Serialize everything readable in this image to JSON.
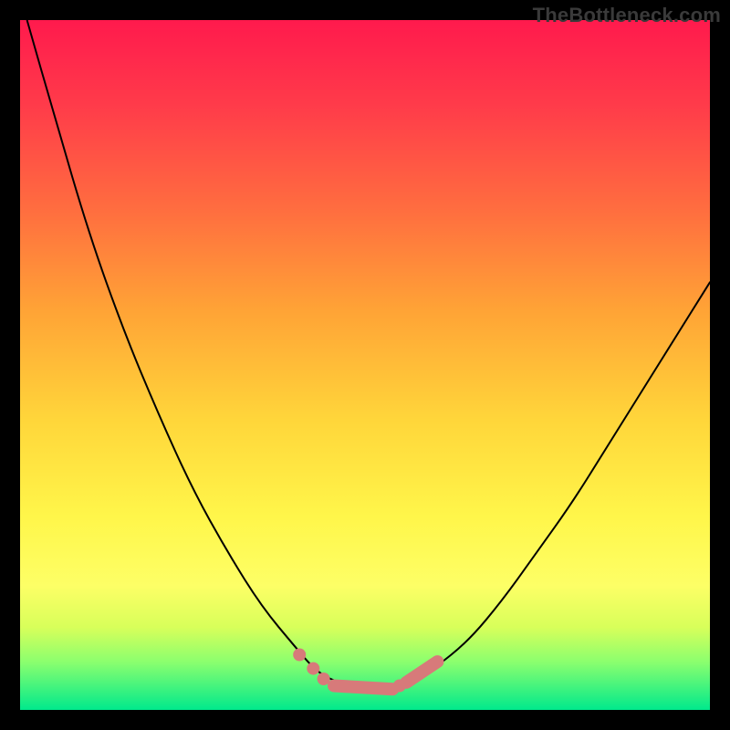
{
  "watermark": "TheBottleneck.com",
  "colors": {
    "background": "#000000",
    "curve": "#000000",
    "markers": "#d77a7a",
    "gradient_top": "#ff1a4d",
    "gradient_bottom": "#00e98c"
  },
  "chart_data": {
    "type": "line",
    "title": "",
    "xlabel": "",
    "ylabel": "",
    "xlim": [
      0,
      100
    ],
    "ylim": [
      0,
      100
    ],
    "grid": false,
    "legend": false,
    "note": "V-shaped bottleneck curve over a vertical rainbow gradient. Values estimated from pixel positions (top-left origin inside the 756×756 plot area). Higher y = further down the image (toward green/good zone).",
    "series": [
      {
        "name": "curve",
        "x": [
          1,
          5,
          10,
          15,
          20,
          25,
          30,
          35,
          40,
          43,
          46,
          50,
          54,
          57,
          60,
          65,
          70,
          75,
          80,
          85,
          90,
          95,
          100
        ],
        "y": [
          0,
          14,
          31,
          45,
          57,
          68,
          77,
          85,
          91,
          94.5,
          96,
          97,
          97,
          96,
          94,
          90,
          84,
          77,
          70,
          62,
          54,
          46,
          38
        ]
      }
    ],
    "markers": [
      {
        "type": "dot",
        "x": 40.5,
        "y": 92
      },
      {
        "type": "dot",
        "x": 42.5,
        "y": 94
      },
      {
        "type": "dot",
        "x": 44.0,
        "y": 95.5
      },
      {
        "type": "segment",
        "x1": 45.5,
        "y1": 96.5,
        "x2": 54.0,
        "y2": 97.0
      },
      {
        "type": "dot",
        "x": 55.0,
        "y": 96.5
      },
      {
        "type": "segment",
        "x1": 56.0,
        "y1": 96,
        "x2": 60.5,
        "y2": 93
      }
    ]
  }
}
